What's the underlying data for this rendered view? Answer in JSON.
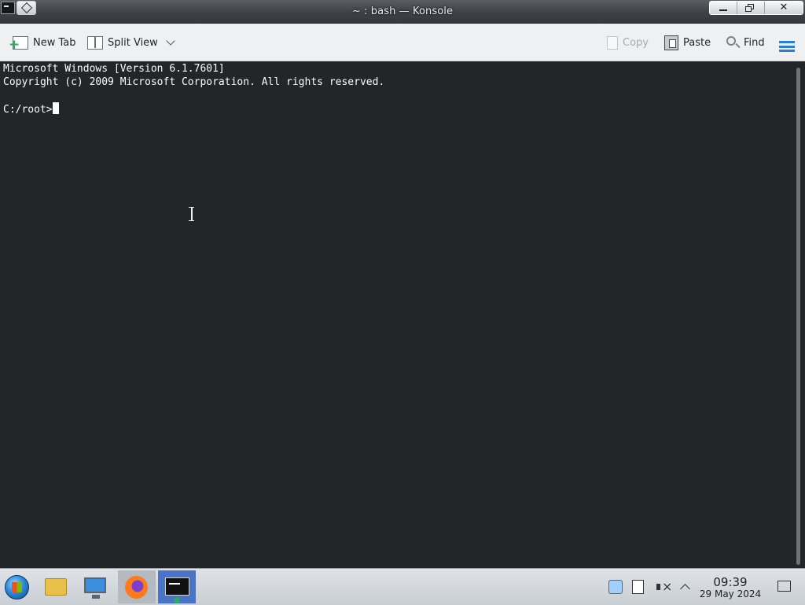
{
  "window": {
    "title": "~ : bash — Konsole"
  },
  "toolbar": {
    "new_tab": "New Tab",
    "split_view": "Split View",
    "copy": "Copy",
    "paste": "Paste",
    "find": "Find"
  },
  "terminal": {
    "lines": [
      "Microsoft Windows [Version 6.1.7601]",
      "Copyright (c) 2009 Microsoft Corporation. All rights reserved.",
      ""
    ],
    "prompt": "C:/root>"
  },
  "taskbar": {
    "apps": [
      "start-menu-icon",
      "file-manager-icon",
      "system-settings-icon",
      "firefox-icon",
      "konsole-icon"
    ],
    "tray_icons": [
      "clipboard-icon",
      "battery-icon",
      "volume-muted-icon",
      "show-hidden-icon"
    ],
    "clock_time": "09:39",
    "clock_date": "29 May 2024"
  },
  "colors": {
    "terminal_bg": "#232627",
    "terminal_fg": "#fcfcfc",
    "accent": "#2a7fd4"
  }
}
